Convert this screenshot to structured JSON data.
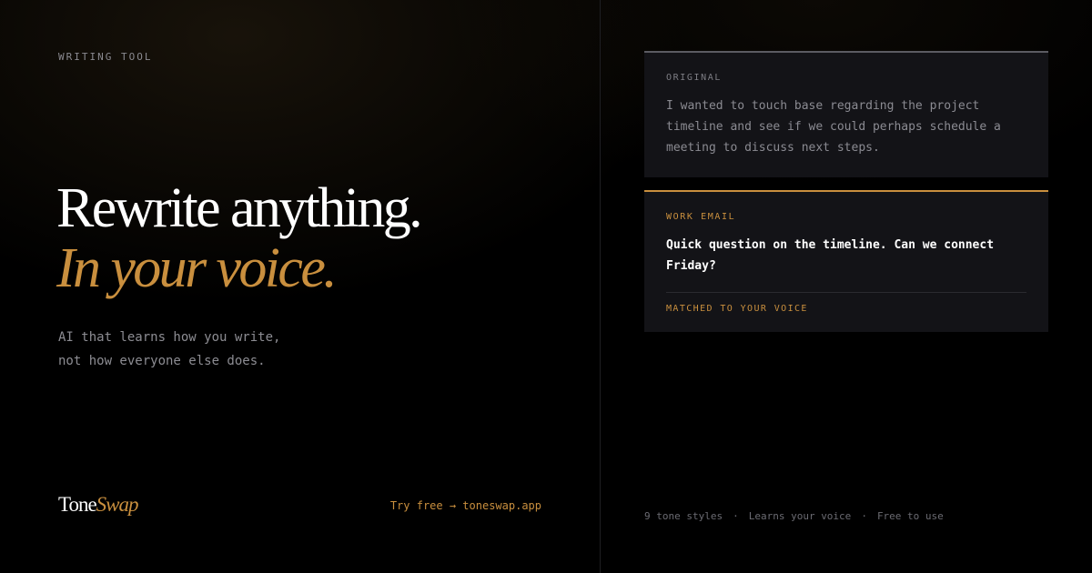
{
  "kicker": "WRITING TOOL",
  "headline": {
    "line1": "Rewrite anything.",
    "line2": "In your voice."
  },
  "subtitle": {
    "line1": "AI that learns how you write,",
    "line2": "not how everyone else does."
  },
  "brand": {
    "part1": "Tone",
    "part2": "Swap"
  },
  "cta": "Try free → toneswap.app",
  "original_card": {
    "label": "ORIGINAL",
    "lines": [
      "I wanted to touch base regarding the project",
      "timeline and see if we could perhaps schedule a",
      "meeting to discuss next steps."
    ]
  },
  "result_card": {
    "label": "WORK EMAIL",
    "lines": [
      "Quick question on the timeline. Can we connect",
      "Friday?"
    ],
    "footer": "MATCHED TO YOUR VOICE"
  },
  "features": {
    "items": [
      "9 tone styles",
      "Learns your voice",
      "Free to use"
    ],
    "separator": "·"
  },
  "colors": {
    "accent": "#c98f3e",
    "background": "#000000",
    "card": "#131317",
    "muted_text": "#8d8d93"
  }
}
